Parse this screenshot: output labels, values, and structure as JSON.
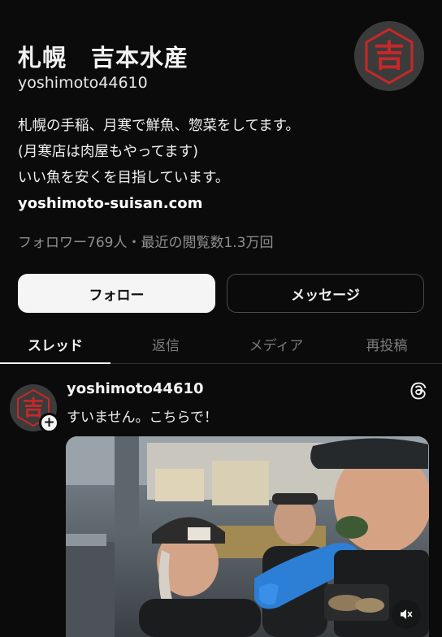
{
  "profile": {
    "name": "札幌　吉本水産",
    "handle": "yoshimoto44610",
    "avatar_char": "吉",
    "bio_lines": [
      "札幌の手稲、月寒で鮮魚、惣菜をしてます。",
      "(月寒店は肉屋もやってます)",
      "いい魚を安くを目指しています。"
    ],
    "link": "yoshimoto-suisan.com",
    "stats": "フォロワー769人・最近の閲覧数1.3万回"
  },
  "buttons": {
    "follow": "フォロー",
    "message": "メッセージ"
  },
  "tabs": [
    {
      "label": "スレッド"
    },
    {
      "label": "返信"
    },
    {
      "label": "メディア"
    },
    {
      "label": "再投稿"
    }
  ],
  "post": {
    "author": "yoshimoto44610",
    "text": "すいません。こちらで！",
    "avatar_char": "吉",
    "icons": {
      "threads": "threads-icon",
      "mute": "mute-icon",
      "follow_plus": "plus-icon"
    }
  },
  "colors": {
    "background": "#0b0b0b",
    "logo_red": "#c62828",
    "follow_button_bg": "#f5f5f5",
    "muted_text": "#8f8f8f"
  }
}
